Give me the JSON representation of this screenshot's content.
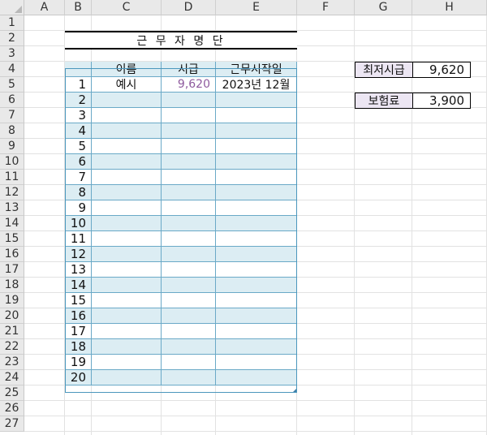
{
  "columns": [
    "A",
    "B",
    "C",
    "D",
    "E",
    "F",
    "G",
    "H"
  ],
  "rows": [
    "1",
    "2",
    "3",
    "4",
    "5",
    "6",
    "7",
    "8",
    "9",
    "10",
    "11",
    "12",
    "13",
    "14",
    "15",
    "16",
    "17",
    "18",
    "19",
    "20",
    "21",
    "22",
    "23",
    "24",
    "25",
    "26",
    "27"
  ],
  "title": "근 무 자 명 단",
  "table": {
    "headers": [
      "이름",
      "시급",
      "근무시작일"
    ],
    "rows": [
      {
        "no": "1",
        "name": "예시",
        "wage": "9,620",
        "start": "2023년 12월"
      },
      {
        "no": "2",
        "name": "",
        "wage": "",
        "start": ""
      },
      {
        "no": "3",
        "name": "",
        "wage": "",
        "start": ""
      },
      {
        "no": "4",
        "name": "",
        "wage": "",
        "start": ""
      },
      {
        "no": "5",
        "name": "",
        "wage": "",
        "start": ""
      },
      {
        "no": "6",
        "name": "",
        "wage": "",
        "start": ""
      },
      {
        "no": "7",
        "name": "",
        "wage": "",
        "start": ""
      },
      {
        "no": "8",
        "name": "",
        "wage": "",
        "start": ""
      },
      {
        "no": "9",
        "name": "",
        "wage": "",
        "start": ""
      },
      {
        "no": "10",
        "name": "",
        "wage": "",
        "start": ""
      },
      {
        "no": "11",
        "name": "",
        "wage": "",
        "start": ""
      },
      {
        "no": "12",
        "name": "",
        "wage": "",
        "start": ""
      },
      {
        "no": "13",
        "name": "",
        "wage": "",
        "start": ""
      },
      {
        "no": "14",
        "name": "",
        "wage": "",
        "start": ""
      },
      {
        "no": "15",
        "name": "",
        "wage": "",
        "start": ""
      },
      {
        "no": "16",
        "name": "",
        "wage": "",
        "start": ""
      },
      {
        "no": "17",
        "name": "",
        "wage": "",
        "start": ""
      },
      {
        "no": "18",
        "name": "",
        "wage": "",
        "start": ""
      },
      {
        "no": "19",
        "name": "",
        "wage": "",
        "start": ""
      },
      {
        "no": "20",
        "name": "",
        "wage": "",
        "start": ""
      }
    ]
  },
  "side": {
    "min_wage_label": "최저시급",
    "min_wage_value": "9,620",
    "insurance_label": "보험료",
    "insurance_value": "3,900"
  },
  "colors": {
    "band": "#dcedf3",
    "table_border": "#4b97bd",
    "label_fill": "#ece6f3",
    "wage_text": "#8e5a9e"
  }
}
